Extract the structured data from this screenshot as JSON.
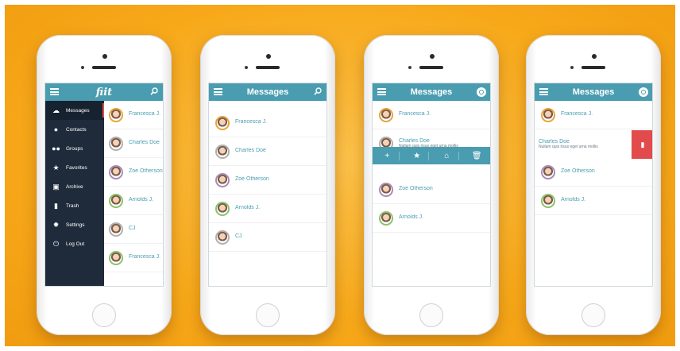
{
  "colors": {
    "accent": "#4a9db0",
    "background": "#f7a91a",
    "sidebar": "#1f2b3a",
    "delete": "#e24b4b"
  },
  "phone1": {
    "logo": "fiit",
    "sidebar_items": [
      {
        "label": "Messages",
        "icon": "chat-icon"
      },
      {
        "label": "Contacts",
        "icon": "person-icon"
      },
      {
        "label": "Groups",
        "icon": "group-icon"
      },
      {
        "label": "Favorites",
        "icon": "star-icon"
      },
      {
        "label": "Archive",
        "icon": "archive-icon"
      },
      {
        "label": "Trash",
        "icon": "trash-icon"
      },
      {
        "label": "Settings",
        "icon": "gear-icon"
      },
      {
        "label": "Log Out",
        "icon": "power-icon"
      }
    ],
    "peek_names": [
      "Francesca J.",
      "Charles Doe",
      "Zoe Otherson",
      "Arnolds J.",
      "CJ",
      "Francesca J."
    ]
  },
  "phone2": {
    "title": "Messages",
    "rows": [
      {
        "name": "Francesca J.",
        "preview": ""
      },
      {
        "name": "Charles Doe",
        "preview": ""
      },
      {
        "name": "Zoe Otherson",
        "preview": ""
      },
      {
        "name": "Arnolds J.",
        "preview": ""
      },
      {
        "name": "CJ",
        "preview": ""
      }
    ]
  },
  "phone3": {
    "title": "Messages",
    "rows_top": [
      {
        "name": "Francesca J.",
        "preview": ""
      },
      {
        "name": "Charles Doe",
        "preview": "Nullam quis risus eget urna mollis"
      }
    ],
    "actions": [
      "+",
      "★",
      "⌂",
      "🗑"
    ],
    "rows_bottom": [
      {
        "name": "Zoe Otherson",
        "preview": ""
      },
      {
        "name": "Arnolds J.",
        "preview": ""
      }
    ]
  },
  "phone4": {
    "title": "Messages",
    "row_first": {
      "name": "Francesca J.",
      "preview": ""
    },
    "row_swiped": {
      "name": "Charles Doe",
      "preview": "Nullam quis risus eget urna mollis"
    },
    "rows_after": [
      {
        "name": "Zoe Otherson",
        "preview": ""
      },
      {
        "name": "Arnolds J.",
        "preview": ""
      }
    ]
  }
}
